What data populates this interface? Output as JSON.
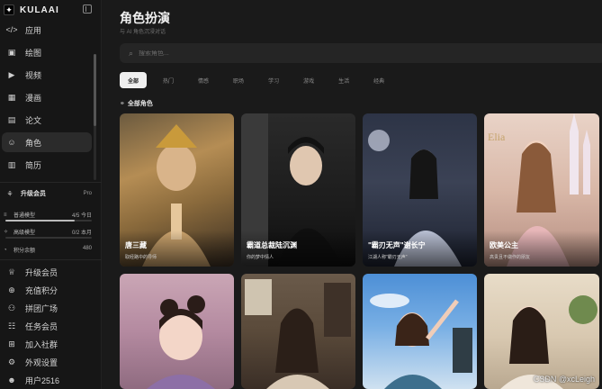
{
  "brand": {
    "logo_letter": "✦",
    "name": "KULAAI"
  },
  "sidebar": {
    "items": [
      {
        "icon": "</>",
        "icon_name": "code-icon",
        "label": "应用",
        "active": false
      },
      {
        "icon": "▣",
        "icon_name": "image-icon",
        "label": "绘图",
        "active": false
      },
      {
        "icon": "▶",
        "icon_name": "video-icon",
        "label": "视频",
        "active": false
      },
      {
        "icon": "▦",
        "icon_name": "comic-icon",
        "label": "漫画",
        "active": false
      },
      {
        "icon": "▤",
        "icon_name": "paper-icon",
        "label": "论文",
        "active": false
      },
      {
        "icon": "☺",
        "icon_name": "role-icon",
        "label": "角色",
        "active": true
      },
      {
        "icon": "▥",
        "icon_name": "resume-icon",
        "label": "简历",
        "active": false
      }
    ],
    "upgrade": {
      "icon": "⚘",
      "label": "升级会员",
      "badge": "Pro"
    },
    "usage": [
      {
        "icon": "≡",
        "name": "普通模型",
        "count": "4/5 今日",
        "fraction": 0.8
      },
      {
        "icon": "✧",
        "name": "高级模型",
        "count": "0/2 本月",
        "fraction": 0
      },
      {
        "icon": "◔",
        "name": "积分余额",
        "count": "480",
        "fraction": null
      }
    ],
    "bottom": [
      {
        "icon": "♕",
        "icon_name": "crown-icon",
        "label": "升级会员"
      },
      {
        "icon": "⊕",
        "icon_name": "points-icon",
        "label": "充值积分"
      },
      {
        "icon": "⚇",
        "icon_name": "group-icon",
        "label": "拼团广场"
      },
      {
        "icon": "☷",
        "icon_name": "member-icon",
        "label": "任务会员"
      },
      {
        "icon": "⊞",
        "icon_name": "community-icon",
        "label": "加入社群"
      },
      {
        "icon": "⚙",
        "icon_name": "gear-icon",
        "label": "外观设置"
      },
      {
        "icon": "☻",
        "icon_name": "user-icon",
        "label": "用户2516"
      }
    ]
  },
  "main": {
    "title": "角色扮演",
    "subtitle": "与 AI 角色沉浸对话",
    "search_placeholder": "搜索角色...",
    "tabs": [
      "全部",
      "热门",
      "情感",
      "职场",
      "学习",
      "游戏",
      "生活",
      "经典"
    ],
    "active_tab": 0,
    "section_label": "全部角色",
    "cards": [
      {
        "title": "唐三藏",
        "desc": "取经路中的导师"
      },
      {
        "title": "霸道总裁陆沉渊",
        "desc": "你的梦中情人"
      },
      {
        "title": "\"霸刃无声\"谢长宁",
        "desc": "江湖人称\"霸刃无声\""
      },
      {
        "title": "欧美公主",
        "desc": "高贵且不做作的朋友"
      },
      {
        "title": "",
        "desc": ""
      },
      {
        "title": "",
        "desc": ""
      },
      {
        "title": "",
        "desc": ""
      },
      {
        "title": "",
        "desc": ""
      }
    ]
  },
  "watermark": "CSDN @xcLeigh"
}
